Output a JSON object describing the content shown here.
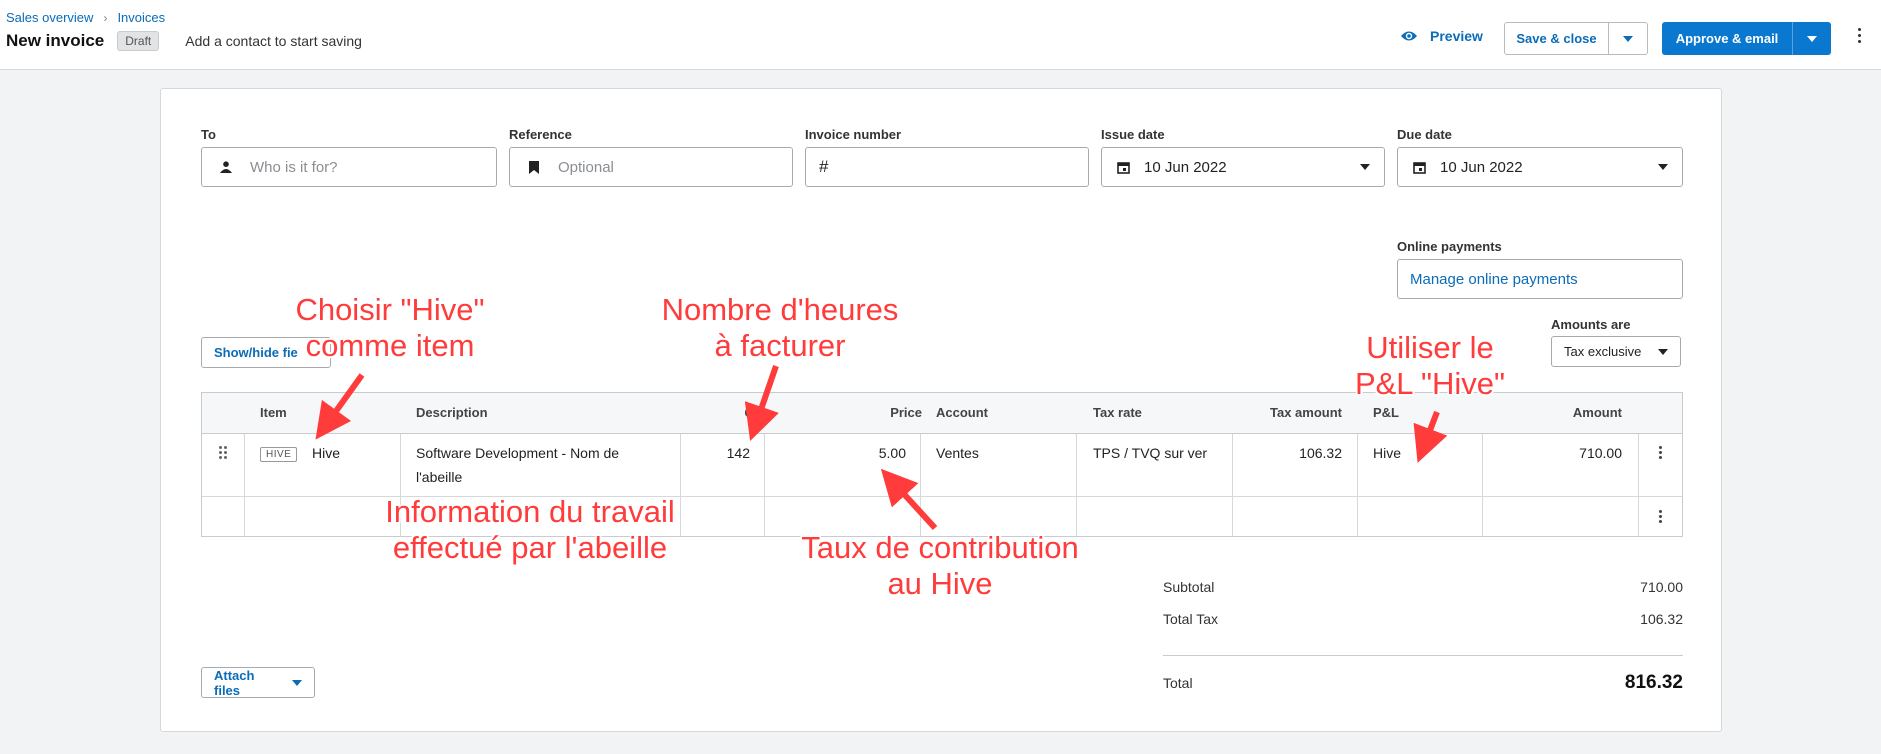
{
  "breadcrumb": {
    "parent": "Sales overview",
    "current": "Invoices"
  },
  "header": {
    "title": "New invoice",
    "status": "Draft",
    "hint": "Add a contact to start saving",
    "preview_label": "Preview",
    "save_label": "Save & close",
    "approve_label": "Approve & email"
  },
  "form": {
    "to": {
      "label": "To",
      "placeholder": "Who is it for?"
    },
    "reference": {
      "label": "Reference",
      "placeholder": "Optional"
    },
    "invoice_number": {
      "label": "Invoice number",
      "prefix": "#"
    },
    "issue_date": {
      "label": "Issue date",
      "value": "10 Jun 2022"
    },
    "due_date": {
      "label": "Due date",
      "value": "10 Jun 2022"
    },
    "online_payments": {
      "label": "Online payments",
      "link": "Manage online payments"
    },
    "amounts_are": {
      "label": "Amounts are",
      "value": "Tax exclusive"
    },
    "show_hide_fields": "Show/hide fie"
  },
  "table": {
    "headers": [
      "Item",
      "Description",
      "Qty",
      "Price",
      "Account",
      "Tax rate",
      "Tax amount",
      "P&L",
      "Amount"
    ],
    "rows": [
      {
        "item_code": "HIVE",
        "item": "Hive",
        "description_line1": "Software Development - Nom de",
        "description_line2": "l'abeille",
        "qty": "142",
        "price": "5.00",
        "account": "Ventes",
        "tax_rate": "TPS / TVQ sur ver",
        "tax_amount": "106.32",
        "pl": "Hive",
        "amount": "710.00"
      }
    ]
  },
  "totals": {
    "subtotal_label": "Subtotal",
    "subtotal": "710.00",
    "tax_label": "Total Tax",
    "tax": "106.32",
    "total_label": "Total",
    "total": "816.32"
  },
  "attach_files": "Attach files",
  "annotations": {
    "item": "Choisir \"Hive\"\ncomme item",
    "hours": "Nombre d'heures\nà facturer",
    "pl": "Utiliser le\nP&L \"Hive\"",
    "work": "Information du travail\neffectué par  l'abeille",
    "rate": "Taux de contribution\nau Hive"
  },
  "colors": {
    "accent": "#0b78d0",
    "link": "#0b6cb8",
    "annotation": "#ff3b3b"
  }
}
